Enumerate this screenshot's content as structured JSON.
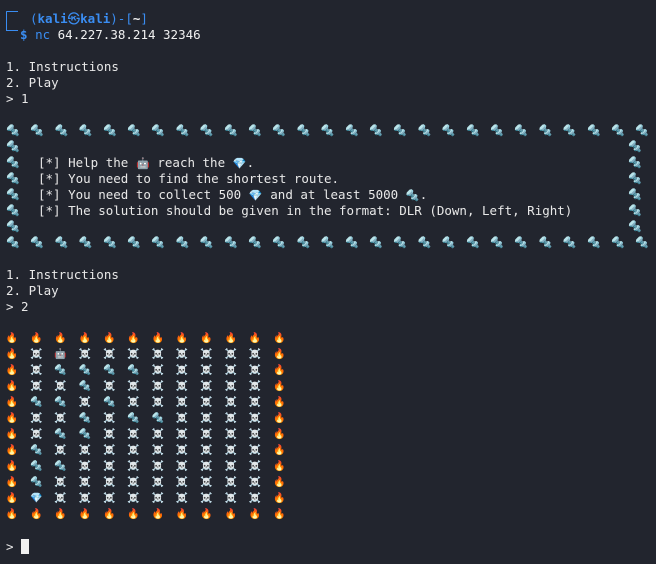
{
  "terminal": {
    "user": "kali",
    "host": "kali",
    "at_symbol": "㉿",
    "cwd": "~",
    "command_name": "nc",
    "command_args": "64.227.38.214 32346",
    "prompt_symbol": "$"
  },
  "menu_first": {
    "item1": "1. Instructions",
    "item2": "2. Play",
    "input": "> 1"
  },
  "instructions": {
    "line1_prefix": "[*] Help the",
    "line1_mid": "reach the",
    "line1_suffix": ".",
    "line2": "[*] You need to find the shortest route.",
    "line3_prefix": "[*] You need to collect 500",
    "line3_mid": "and at least 5000",
    "line3_suffix": ".",
    "line4": "[*] The solution should be given in the format: DLR (Down, Left, Right)"
  },
  "menu_second": {
    "item1": "1. Instructions",
    "item2": "2. Play",
    "input": "> 2"
  },
  "final_prompt": ">",
  "icons": {
    "bolt": "🔩",
    "robot": "🤖",
    "diamond": "💎",
    "fire": "🔥",
    "skull": "☠️"
  },
  "grid_legend": {
    "B": "bolt",
    "R": "robot",
    "D": "diamond",
    "F": "fire",
    "S": "skull"
  },
  "game_grid": [
    "FFFFFFFFFFFF",
    "FSRSSSSSSSSF",
    "FSBBBBSSSSSF",
    "FSSBSSSSSSSF",
    "FBBSBSSSSSSF",
    "FSSBSBBSSSSF",
    "FSBBSSSSSSSF",
    "FBSSSSSSSSSF",
    "FBBSSSSSSSSF",
    "FBSSSSSSSSSF",
    "FDSSSSSSSSSF",
    "FFFFFFFFFFFF"
  ],
  "colors": {
    "background": "#22252e",
    "prompt_blue": "#3a8df2",
    "text": "#e8e8e8"
  }
}
